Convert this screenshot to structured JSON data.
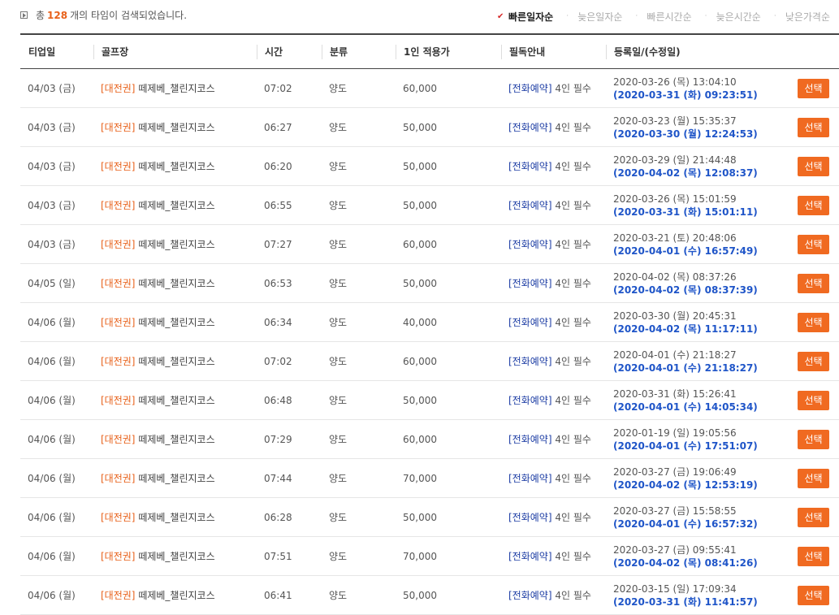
{
  "summary": {
    "prefix": "총",
    "count": "128",
    "suffix": "개의 타임이 검색되었습니다."
  },
  "sort_options": [
    {
      "label": "빠른일자순",
      "active": true
    },
    {
      "label": "늦은일자순",
      "active": false
    },
    {
      "label": "빠른시간순",
      "active": false
    },
    {
      "label": "늦은시간순",
      "active": false
    },
    {
      "label": "낮은가격순",
      "active": false
    }
  ],
  "columns": [
    "티업일",
    "골프장",
    "시간",
    "분류",
    "1인 적용가",
    "필독안내",
    "등록일/(수정일)"
  ],
  "button_label": "선택",
  "rows": [
    {
      "date": "04/03 (금)",
      "region": "[대전권]",
      "course": "떼제베_챌린지코스",
      "time": "07:02",
      "type": "양도",
      "price": "60,000",
      "notice_phone": "[전화예약]",
      "notice_rest": "4인 필수",
      "registered": "2020-03-26 (목) 13:04:10",
      "modified": "(2020-03-31 (화) 09:23:51)"
    },
    {
      "date": "04/03 (금)",
      "region": "[대전권]",
      "course": "떼제베_챌린지코스",
      "time": "06:27",
      "type": "양도",
      "price": "50,000",
      "notice_phone": "[전화예약]",
      "notice_rest": "4인 필수",
      "registered": "2020-03-23 (월) 15:35:37",
      "modified": "(2020-03-30 (월) 12:24:53)"
    },
    {
      "date": "04/03 (금)",
      "region": "[대전권]",
      "course": "떼제베_챌린지코스",
      "time": "06:20",
      "type": "양도",
      "price": "50,000",
      "notice_phone": "[전화예약]",
      "notice_rest": "4인 필수",
      "registered": "2020-03-29 (일) 21:44:48",
      "modified": "(2020-04-02 (목) 12:08:37)"
    },
    {
      "date": "04/03 (금)",
      "region": "[대전권]",
      "course": "떼제베_챌린지코스",
      "time": "06:55",
      "type": "양도",
      "price": "50,000",
      "notice_phone": "[전화예약]",
      "notice_rest": "4인 필수",
      "registered": "2020-03-26 (목) 15:01:59",
      "modified": "(2020-03-31 (화) 15:01:11)"
    },
    {
      "date": "04/03 (금)",
      "region": "[대전권]",
      "course": "떼제베_챌린지코스",
      "time": "07:27",
      "type": "양도",
      "price": "60,000",
      "notice_phone": "[전화예약]",
      "notice_rest": "4인 필수",
      "registered": "2020-03-21 (토) 20:48:06",
      "modified": "(2020-04-01 (수) 16:57:49)"
    },
    {
      "date": "04/05 (일)",
      "region": "[대전권]",
      "course": "떼제베_챌린지코스",
      "time": "06:53",
      "type": "양도",
      "price": "50,000",
      "notice_phone": "[전화예약]",
      "notice_rest": "4인 필수",
      "registered": "2020-04-02 (목) 08:37:26",
      "modified": "(2020-04-02 (목) 08:37:39)"
    },
    {
      "date": "04/06 (월)",
      "region": "[대전권]",
      "course": "떼제베_챌린지코스",
      "time": "06:34",
      "type": "양도",
      "price": "40,000",
      "notice_phone": "[전화예약]",
      "notice_rest": "4인 필수",
      "registered": "2020-03-30 (월) 20:45:31",
      "modified": "(2020-04-02 (목) 11:17:11)"
    },
    {
      "date": "04/06 (월)",
      "region": "[대전권]",
      "course": "떼제베_챌린지코스",
      "time": "07:02",
      "type": "양도",
      "price": "60,000",
      "notice_phone": "[전화예약]",
      "notice_rest": "4인 필수",
      "registered": "2020-04-01 (수) 21:18:27",
      "modified": "(2020-04-01 (수) 21:18:27)"
    },
    {
      "date": "04/06 (월)",
      "region": "[대전권]",
      "course": "떼제베_챌린지코스",
      "time": "06:48",
      "type": "양도",
      "price": "50,000",
      "notice_phone": "[전화예약]",
      "notice_rest": "4인 필수",
      "registered": "2020-03-31 (화) 15:26:41",
      "modified": "(2020-04-01 (수) 14:05:34)"
    },
    {
      "date": "04/06 (월)",
      "region": "[대전권]",
      "course": "떼제베_챌린지코스",
      "time": "07:29",
      "type": "양도",
      "price": "60,000",
      "notice_phone": "[전화예약]",
      "notice_rest": "4인 필수",
      "registered": "2020-01-19 (일) 19:05:56",
      "modified": "(2020-04-01 (수) 17:51:07)"
    },
    {
      "date": "04/06 (월)",
      "region": "[대전권]",
      "course": "떼제베_챌린지코스",
      "time": "07:44",
      "type": "양도",
      "price": "70,000",
      "notice_phone": "[전화예약]",
      "notice_rest": "4인 필수",
      "registered": "2020-03-27 (금) 19:06:49",
      "modified": "(2020-04-02 (목) 12:53:19)"
    },
    {
      "date": "04/06 (월)",
      "region": "[대전권]",
      "course": "떼제베_챌린지코스",
      "time": "06:28",
      "type": "양도",
      "price": "50,000",
      "notice_phone": "[전화예약]",
      "notice_rest": "4인 필수",
      "registered": "2020-03-27 (금) 15:58:55",
      "modified": "(2020-04-01 (수) 16:57:32)"
    },
    {
      "date": "04/06 (월)",
      "region": "[대전권]",
      "course": "떼제베_챌린지코스",
      "time": "07:51",
      "type": "양도",
      "price": "70,000",
      "notice_phone": "[전화예약]",
      "notice_rest": "4인 필수",
      "registered": "2020-03-27 (금) 09:55:41",
      "modified": "(2020-04-02 (목) 08:41:26)"
    },
    {
      "date": "04/06 (월)",
      "region": "[대전권]",
      "course": "떼제베_챌린지코스",
      "time": "06:41",
      "type": "양도",
      "price": "50,000",
      "notice_phone": "[전화예약]",
      "notice_rest": "4인 필수",
      "registered": "2020-03-15 (일) 17:09:34",
      "modified": "(2020-03-31 (화) 11:41:57)"
    }
  ]
}
